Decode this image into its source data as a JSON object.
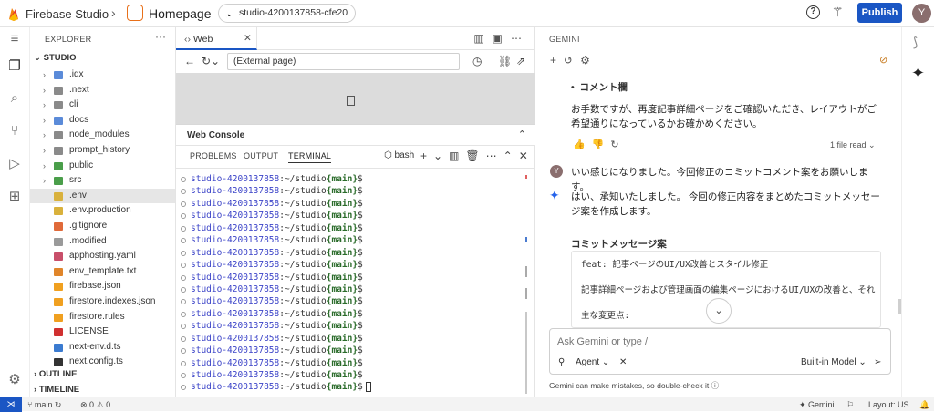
{
  "topbar": {
    "brand": "Firebase Studio",
    "breadcrumb_sep": "›",
    "page": "Homepage",
    "workspace": "studio-4200137858-cfe20",
    "publish_label": "Publish",
    "avatar_initial": "Y",
    "accent_color": "#1a56c4"
  },
  "activity_bar": {
    "icons": [
      "menu-icon",
      "explorer-icon",
      "search-icon",
      "source-control-icon",
      "run-debug-icon",
      "extensions-icon",
      "settings-icon"
    ]
  },
  "explorer": {
    "header": "EXPLORER",
    "root": "STUDIO",
    "items": [
      {
        "name": ".idx",
        "type": "folder",
        "color": "#5b8bd9"
      },
      {
        "name": ".next",
        "type": "folder",
        "color": "#8a8a8a"
      },
      {
        "name": "cli",
        "type": "folder",
        "color": "#8a8a8a"
      },
      {
        "name": "docs",
        "type": "folder",
        "color": "#5b8bd9"
      },
      {
        "name": "node_modules",
        "type": "folder",
        "color": "#8a8a8a"
      },
      {
        "name": "prompt_history",
        "type": "folder",
        "color": "#8a8a8a"
      },
      {
        "name": "public",
        "type": "folder",
        "color": "#4a9e4a"
      },
      {
        "name": "src",
        "type": "folder",
        "color": "#4a9e4a"
      },
      {
        "name": ".env",
        "type": "file",
        "color": "#d9b13c",
        "selected": true
      },
      {
        "name": ".env.production",
        "type": "file",
        "color": "#d9b13c"
      },
      {
        "name": ".gitignore",
        "type": "file",
        "color": "#e06a3a"
      },
      {
        "name": ".modified",
        "type": "file",
        "color": "#9a9a9a"
      },
      {
        "name": "apphosting.yaml",
        "type": "file",
        "color": "#c84f6a"
      },
      {
        "name": "env_template.txt",
        "type": "file",
        "color": "#e0852a"
      },
      {
        "name": "firebase.json",
        "type": "file",
        "color": "#f0a020"
      },
      {
        "name": "firestore.indexes.json",
        "type": "file",
        "color": "#f0a020"
      },
      {
        "name": "firestore.rules",
        "type": "file",
        "color": "#f0a020"
      },
      {
        "name": "LICENSE",
        "type": "file",
        "color": "#d03030"
      },
      {
        "name": "next-env.d.ts",
        "type": "file",
        "color": "#3b7bd0"
      },
      {
        "name": "next.config.ts",
        "type": "file",
        "color": "#333333"
      }
    ],
    "outline": "OUTLINE",
    "timeline": "TIMELINE"
  },
  "web": {
    "tab_label": "Web",
    "url_value": "(External page)",
    "console_title": "Web Console",
    "terminal_tabs": [
      "PROBLEMS",
      "OUTPUT",
      "TERMINAL"
    ],
    "active_terminal_tab": "TERMINAL",
    "shell": "bash",
    "prompt_host": "studio-4200137858",
    "prompt_path": ":~/studio",
    "prompt_branch": "{main}",
    "prompt_end": "$",
    "line_count": 18
  },
  "gemini": {
    "title": "GEMINI",
    "bullet": "コメント欄",
    "msg1": "お手数ですが、再度記事詳細ページをご確認いただき、レイアウトがご希望通りになっているかお確かめください。",
    "file_read": "1 file read",
    "user_initial": "Y",
    "user_msg": "いい感じになりました。今回修正のコミットコメント案をお願いします。",
    "reply": "はい、承知いたしました。 今回の修正内容をまとめたコミットメッセージ案を作成します。",
    "commit_title": "コミットメッセージ案",
    "commit_lines": [
      "feat: 記事ページのUI/UX改善とスタイル修正",
      "記事詳細ページおよび管理画面の編集ページにおけるUI/UXの改善と、それ",
      "主な変更点:"
    ],
    "input_placeholder": "Ask Gemini or type /",
    "agent_label": "Agent",
    "model_label": "Built-in Model",
    "disclaimer": "Gemini can make mistakes, so double-check it"
  },
  "statusbar": {
    "branch": "main",
    "errors": "0",
    "warnings": "0",
    "gemini": "Gemini",
    "layout": "Layout: US"
  }
}
